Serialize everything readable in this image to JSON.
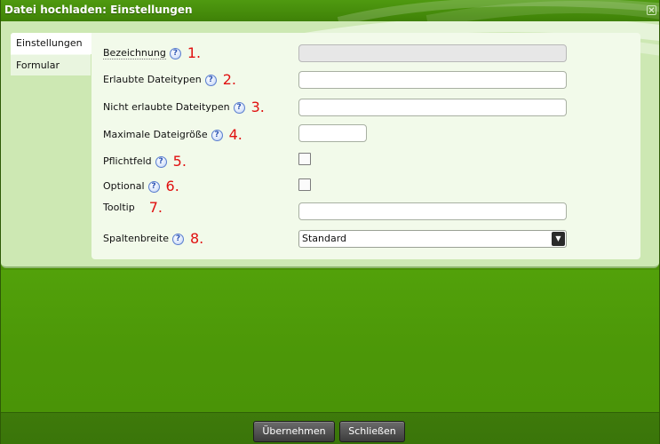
{
  "dialog": {
    "title": "Datei hochladen: Einstellungen",
    "close_icon": "close-icon"
  },
  "tabs": [
    {
      "label": "Einstellungen",
      "active": true
    },
    {
      "label": "Formular",
      "active": false
    }
  ],
  "fields": [
    {
      "label": "Bezeichnung",
      "marker": "1.",
      "type": "text",
      "value": "",
      "disabled": true
    },
    {
      "label": "Erlaubte Dateitypen",
      "marker": "2.",
      "type": "text",
      "value": ""
    },
    {
      "label": "Nicht erlaubte Dateitypen",
      "marker": "3.",
      "type": "text",
      "value": ""
    },
    {
      "label": "Maximale Dateigröße",
      "marker": "4.",
      "type": "text",
      "value": ""
    },
    {
      "label": "Pflichtfeld",
      "marker": "5.",
      "type": "checkbox",
      "checked": false
    },
    {
      "label": "Optional",
      "marker": "6.",
      "type": "checkbox",
      "checked": false
    },
    {
      "label": "Tooltip",
      "marker": "7.",
      "type": "text",
      "value": ""
    },
    {
      "label": "Spaltenbreite",
      "marker": "8.",
      "type": "select",
      "value": "Standard"
    }
  ],
  "help_icon_glyph": "?",
  "footer": {
    "apply_label": "Übernehmen",
    "close_label": "Schließen"
  },
  "colors": {
    "brand_green": "#4c9208",
    "panel_bg": "#f2faea",
    "marker_red": "#e01010"
  }
}
